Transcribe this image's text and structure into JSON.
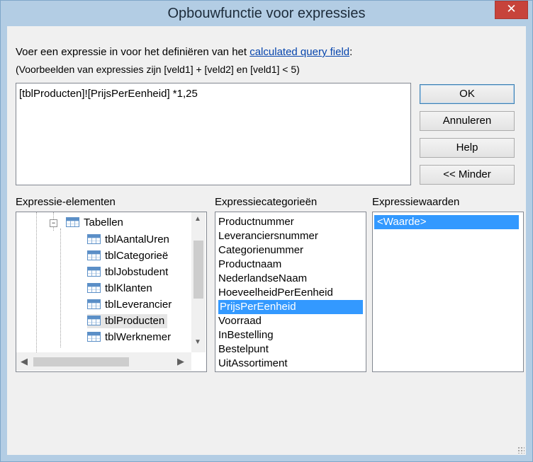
{
  "window": {
    "title": "Opbouwfunctie voor expressies",
    "close_glyph": "✕"
  },
  "instructions": {
    "line1_prefix": "Voer een expressie in voor het definiëren van het ",
    "line1_link": "calculated query field",
    "line1_suffix": ":",
    "line2": "(Voorbeelden van expressies zijn [veld1] + [veld2] en [veld1] < 5)"
  },
  "expression": {
    "value": "[tblProducten]![PrijsPerEenheid] *1,25"
  },
  "buttons": {
    "ok": "OK",
    "cancel": "Annuleren",
    "help": "Help",
    "less": "<< Minder"
  },
  "elements": {
    "label": "Expressie-elementen",
    "tree_root": "Tabellen",
    "tree_items": [
      "tblAantalUren",
      "tblCategorieë",
      "tblJobstudent",
      "tblKlanten",
      "tblLeverancier",
      "tblProducten",
      "tblWerknemer"
    ],
    "selected_index": 5
  },
  "categories": {
    "label": "Expressiecategorieën",
    "items": [
      "Productnummer",
      "Leveranciersnummer",
      "Categorienummer",
      "Productnaam",
      "NederlandseNaam",
      "HoeveelheidPerEenheid",
      "PrijsPerEenheid",
      "Voorraad",
      "InBestelling",
      "Bestelpunt",
      "UitAssortiment"
    ],
    "selected_index": 6
  },
  "values": {
    "label": "Expressiewaarden",
    "items": [
      "<Waarde>"
    ],
    "selected_index": 0
  }
}
